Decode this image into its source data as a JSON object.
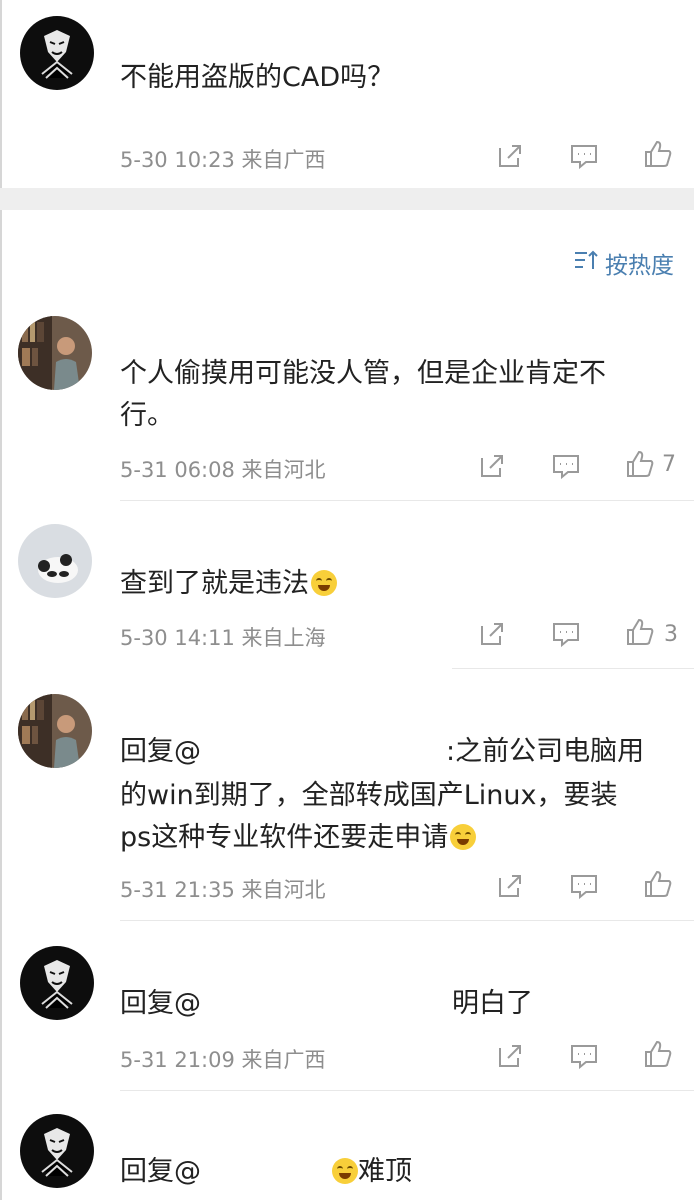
{
  "post": {
    "text": "不能用盗版的CAD吗？",
    "time": "5-30 10:23",
    "source": "来自广西"
  },
  "sort_label": "按热度",
  "comments": [
    {
      "line1": "个人偷摸用可能没人管，但是企业肯定不",
      "line2": "行。",
      "time": "5-31 06:08",
      "source": "来自河北",
      "likes": "7"
    },
    {
      "text": "查到了就是违法",
      "time": "5-30 14:11",
      "source": "来自上海",
      "likes": "3"
    },
    {
      "reply_prefix": "回复@",
      "line1_rest": ":之前公司电脑用",
      "line2": "的win到期了，全部转成国产Linux，要装",
      "line3": "ps这种专业软件还要走申请",
      "time": "5-31 21:35",
      "source": "来自河北"
    },
    {
      "reply_prefix": "回复@",
      "text_rest": "明白了",
      "time": "5-31 21:09",
      "source": "来自广西"
    },
    {
      "reply_prefix": "回复@",
      "text_rest": "难顶"
    }
  ],
  "icons": {
    "share": "share-icon",
    "comment": "comment-icon",
    "like": "thumbs-up-icon",
    "sort": "sort-icon",
    "emoji": "laugh-cry-emoji"
  },
  "colors": {
    "meta": "#8e8e8e",
    "link": "#4b79b5",
    "sort": "#4a7fb0",
    "gap": "#eeeeee"
  }
}
